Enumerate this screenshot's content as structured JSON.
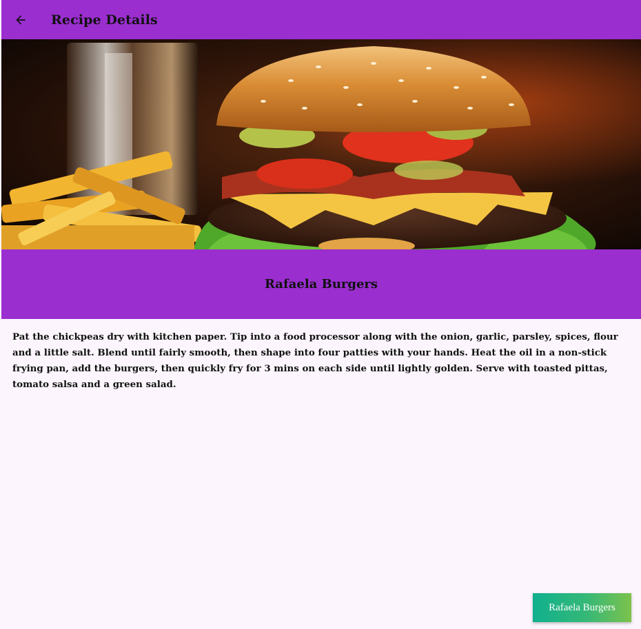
{
  "appbar": {
    "title": "Recipe Details",
    "back_icon": "arrow-left-icon"
  },
  "hero": {
    "image_subject": "burger-with-fries-photo"
  },
  "recipe": {
    "title": "Rafaela Burgers",
    "instructions": "Pat the chickpeas dry with kitchen paper. Tip into a food processor along with the onion, garlic, parsley, spices, flour and a little salt. Blend until fairly smooth, then shape into four patties with your hands. Heat the oil in a non-stick frying pan, add the burgers, then quickly fry for 3 mins on each side until lightly golden. Serve with toasted pittas, tomato salsa and a green salad."
  },
  "action_button": {
    "label": "Rafaela Burgers"
  },
  "colors": {
    "accent": "#9a2ecf",
    "background": "#fcf5fd",
    "button_gradient_start": "#0fb08e",
    "button_gradient_end": "#7cc24c"
  }
}
